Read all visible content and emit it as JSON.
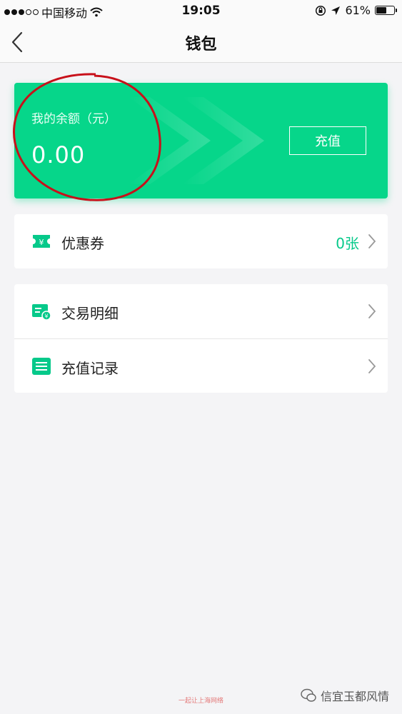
{
  "status_bar": {
    "carrier": "中国移动",
    "time": "19:05",
    "battery_percent": "61%",
    "battery_level": 0.61
  },
  "nav": {
    "title": "钱包"
  },
  "balance_card": {
    "label": "我的余额（元）",
    "amount": "0.00",
    "recharge_label": "充值"
  },
  "coupon": {
    "label": "优惠券",
    "value": "0张"
  },
  "records": [
    {
      "label": "交易明细"
    },
    {
      "label": "充值记录"
    }
  ],
  "footer": {
    "watermark": "一起让上海网络",
    "brand": "信宜玉都风情"
  },
  "colors": {
    "accent": "#06d68a",
    "accent_text": "#06c98a",
    "annotation": "#c8101a"
  }
}
